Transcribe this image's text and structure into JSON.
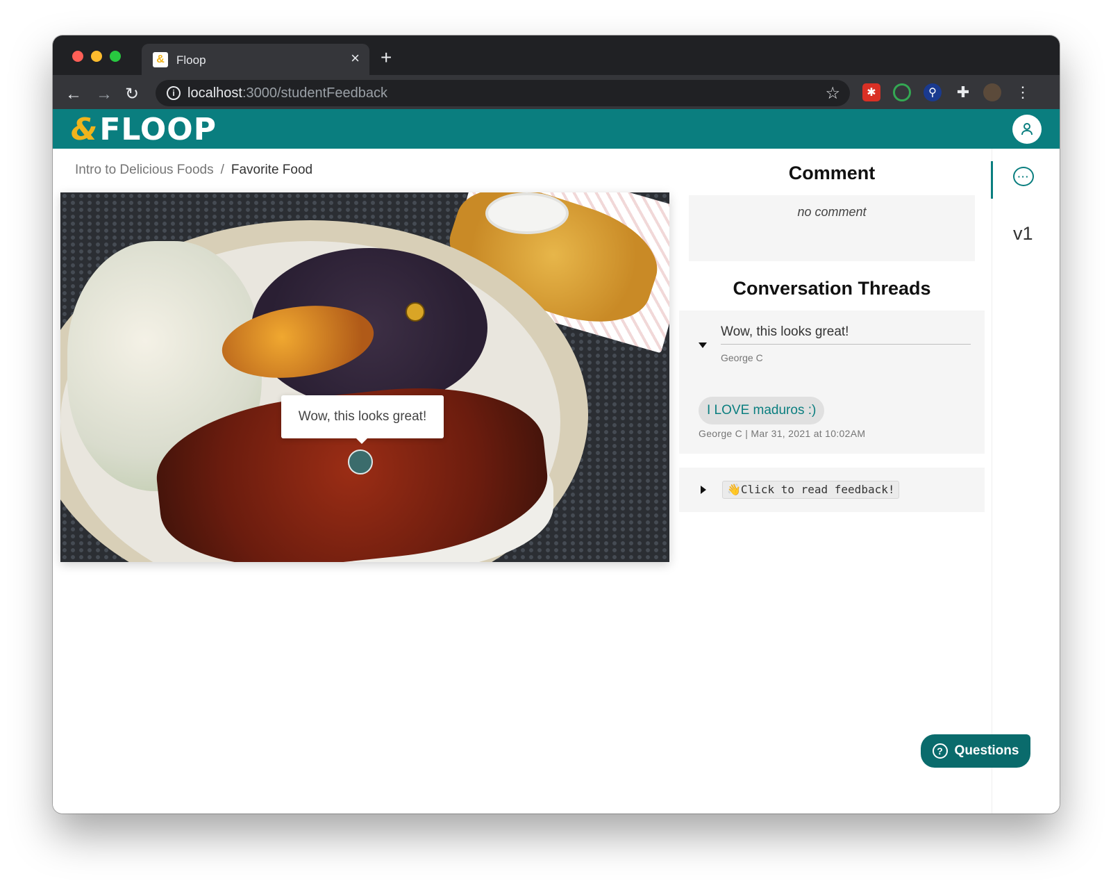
{
  "browser": {
    "tab_title": "Floop",
    "favicon": "floop-favicon",
    "close_glyph": "×",
    "new_tab_glyph": "+",
    "url_host": "localhost",
    "url_rest": ":3000/studentFeedback"
  },
  "app": {
    "logo_amp": "&",
    "logo_text": "FLOOP",
    "brand_color": "#0a7e7f",
    "accent_color": "#f0b41c"
  },
  "breadcrumb": {
    "course": "Intro to Delicious Foods",
    "separator": "/",
    "assignment": "Favorite Food"
  },
  "image": {
    "tooltip": "Wow, this looks great!"
  },
  "comment": {
    "title": "Comment",
    "text": "no comment"
  },
  "threads": {
    "title": "Conversation Threads",
    "items": [
      {
        "heading": "Wow, this looks great!",
        "author": "George C",
        "reply": "I LOVE maduros :)",
        "reply_meta": "George C | Mar 31, 2021 at 10:02AM"
      },
      {
        "button": "👋Click to read feedback!"
      }
    ]
  },
  "rail": {
    "version": "v1"
  },
  "questions": {
    "label": "Questions",
    "icon_glyph": "?"
  }
}
